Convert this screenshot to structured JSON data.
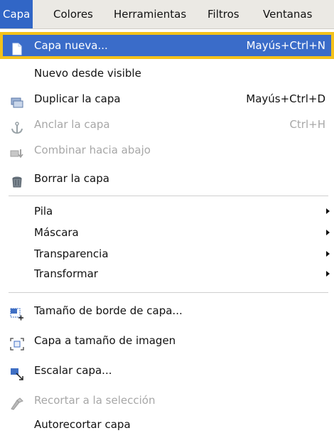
{
  "menubar": {
    "items": [
      {
        "label": "Capa",
        "active": true
      },
      {
        "label": "Colores"
      },
      {
        "label": "Herramientas"
      },
      {
        "label": "Filtros"
      },
      {
        "label": "Ventanas"
      }
    ]
  },
  "menu": {
    "items": [
      {
        "label": "Capa nueva...",
        "shortcut": "Mayús+Ctrl+N",
        "icon": "new-layer-icon",
        "selected": true
      },
      {
        "label": "Nuevo desde visible"
      },
      {
        "label": "Duplicar la capa",
        "shortcut": "Mayús+Ctrl+D",
        "icon": "duplicate-layer-icon"
      },
      {
        "label": "Anclar la capa",
        "shortcut": "Ctrl+H",
        "icon": "anchor-icon",
        "disabled": true
      },
      {
        "label": "Combinar hacia abajo",
        "icon": "merge-down-icon",
        "disabled": true
      },
      {
        "label": "Borrar la capa",
        "icon": "trash-icon"
      },
      {
        "label": "Pila",
        "submenu": true
      },
      {
        "label": "Máscara",
        "submenu": true
      },
      {
        "label": "Transparencia",
        "submenu": true
      },
      {
        "label": "Transformar",
        "submenu": true
      },
      {
        "label": "Tamaño de borde de capa...",
        "icon": "layer-boundary-size-icon"
      },
      {
        "label": "Capa a tamaño de imagen",
        "icon": "layer-to-image-size-icon"
      },
      {
        "label": "Escalar capa...",
        "icon": "scale-layer-icon"
      },
      {
        "label": "Recortar a la selección",
        "icon": "crop-icon",
        "disabled": true
      },
      {
        "label": "Autorecortar capa"
      }
    ]
  },
  "colors": {
    "selection": "#3a6cc9",
    "highlight_outline": "#f4c21a",
    "disabled_text": "#a7a7a7"
  }
}
